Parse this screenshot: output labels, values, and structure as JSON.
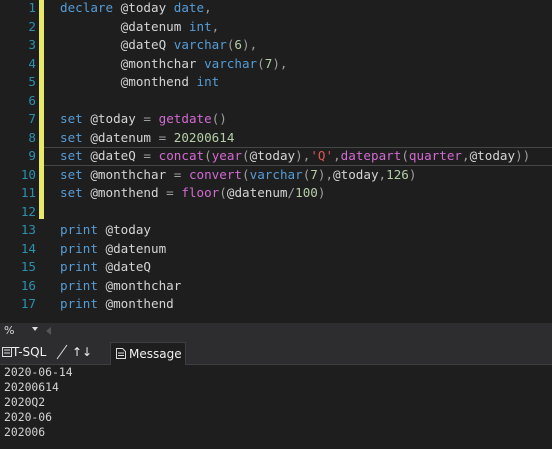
{
  "editor": {
    "lines": [
      {
        "n": "1",
        "tokens": [
          {
            "t": "declare",
            "c": "kw"
          },
          {
            "t": " @today ",
            "c": "var"
          },
          {
            "t": "date",
            "c": "kw"
          },
          {
            "t": ",",
            "c": "op"
          }
        ]
      },
      {
        "n": "2",
        "tokens": [
          {
            "t": "        @datenum ",
            "c": "var"
          },
          {
            "t": "int",
            "c": "kw"
          },
          {
            "t": ",",
            "c": "op"
          }
        ]
      },
      {
        "n": "3",
        "tokens": [
          {
            "t": "        @dateQ ",
            "c": "var"
          },
          {
            "t": "varchar",
            "c": "kw"
          },
          {
            "t": "(",
            "c": "op"
          },
          {
            "t": "6",
            "c": "num"
          },
          {
            "t": "),",
            "c": "op"
          }
        ]
      },
      {
        "n": "4",
        "tokens": [
          {
            "t": "        @monthchar ",
            "c": "var"
          },
          {
            "t": "varchar",
            "c": "kw"
          },
          {
            "t": "(",
            "c": "op"
          },
          {
            "t": "7",
            "c": "num"
          },
          {
            "t": "),",
            "c": "op"
          }
        ]
      },
      {
        "n": "5",
        "tokens": [
          {
            "t": "        @monthend ",
            "c": "var"
          },
          {
            "t": "int",
            "c": "kw"
          }
        ]
      },
      {
        "n": "6",
        "tokens": []
      },
      {
        "n": "7",
        "tokens": [
          {
            "t": "set",
            "c": "kw"
          },
          {
            "t": " @today ",
            "c": "var"
          },
          {
            "t": "=",
            "c": "op"
          },
          {
            "t": " ",
            "c": "var"
          },
          {
            "t": "getdate",
            "c": "fn"
          },
          {
            "t": "()",
            "c": "op"
          }
        ]
      },
      {
        "n": "8",
        "tokens": [
          {
            "t": "set",
            "c": "kw"
          },
          {
            "t": " @datenum ",
            "c": "var"
          },
          {
            "t": "=",
            "c": "op"
          },
          {
            "t": " ",
            "c": "var"
          },
          {
            "t": "20200614",
            "c": "num"
          }
        ]
      },
      {
        "n": "9",
        "tokens": [
          {
            "t": "set",
            "c": "kw"
          },
          {
            "t": " @dateQ ",
            "c": "var"
          },
          {
            "t": "=",
            "c": "op"
          },
          {
            "t": " ",
            "c": "var"
          },
          {
            "t": "concat",
            "c": "fn"
          },
          {
            "t": "(",
            "c": "op"
          },
          {
            "t": "year",
            "c": "fn"
          },
          {
            "t": "(",
            "c": "op"
          },
          {
            "t": "@today",
            "c": "var"
          },
          {
            "t": "),",
            "c": "op"
          },
          {
            "t": "'Q'",
            "c": "str"
          },
          {
            "t": ",",
            "c": "op"
          },
          {
            "t": "datepart",
            "c": "fn"
          },
          {
            "t": "(",
            "c": "op"
          },
          {
            "t": "quarter",
            "c": "fn"
          },
          {
            "t": ",",
            "c": "op"
          },
          {
            "t": "@today",
            "c": "var"
          },
          {
            "t": "))",
            "c": "op"
          }
        ]
      },
      {
        "n": "10",
        "tokens": [
          {
            "t": "set",
            "c": "kw"
          },
          {
            "t": " @monthchar ",
            "c": "var"
          },
          {
            "t": "=",
            "c": "op"
          },
          {
            "t": " ",
            "c": "var"
          },
          {
            "t": "convert",
            "c": "fn"
          },
          {
            "t": "(",
            "c": "op"
          },
          {
            "t": "varchar",
            "c": "kw"
          },
          {
            "t": "(",
            "c": "op"
          },
          {
            "t": "7",
            "c": "num"
          },
          {
            "t": "),",
            "c": "op"
          },
          {
            "t": "@today",
            "c": "var"
          },
          {
            "t": ",",
            "c": "op"
          },
          {
            "t": "126",
            "c": "num"
          },
          {
            "t": ")",
            "c": "op"
          }
        ]
      },
      {
        "n": "11",
        "tokens": [
          {
            "t": "set",
            "c": "kw"
          },
          {
            "t": " @monthend ",
            "c": "var"
          },
          {
            "t": "=",
            "c": "op"
          },
          {
            "t": " ",
            "c": "var"
          },
          {
            "t": "floor",
            "c": "fn"
          },
          {
            "t": "(",
            "c": "op"
          },
          {
            "t": "@datenum",
            "c": "var"
          },
          {
            "t": "/",
            "c": "op"
          },
          {
            "t": "100",
            "c": "num"
          },
          {
            "t": ")",
            "c": "op"
          }
        ]
      },
      {
        "n": "12",
        "tokens": []
      },
      {
        "n": "13",
        "tokens": [
          {
            "t": "print",
            "c": "kw"
          },
          {
            "t": " @today",
            "c": "var"
          }
        ]
      },
      {
        "n": "14",
        "tokens": [
          {
            "t": "print",
            "c": "kw"
          },
          {
            "t": " @datenum",
            "c": "var"
          }
        ]
      },
      {
        "n": "15",
        "tokens": [
          {
            "t": "print",
            "c": "kw"
          },
          {
            "t": " @dateQ",
            "c": "var"
          }
        ]
      },
      {
        "n": "16",
        "tokens": [
          {
            "t": "print",
            "c": "kw"
          },
          {
            "t": " @monthchar",
            "c": "var"
          }
        ]
      },
      {
        "n": "17",
        "tokens": [
          {
            "t": "print",
            "c": "kw"
          },
          {
            "t": " @monthend",
            "c": "var"
          }
        ]
      }
    ],
    "current_line": "9"
  },
  "statusbar": {
    "zoom": "%"
  },
  "tabs": {
    "tsql": "T-SQL",
    "sort_icon": "↑↓",
    "message": "Message"
  },
  "output": {
    "lines": [
      "2020-06-14",
      "20200614",
      "2020Q2",
      "2020-06",
      "202006"
    ]
  },
  "colors": {
    "keyword": "#569cd6",
    "function": "#d16ad1",
    "number": "#b5cea8",
    "string": "#e05555",
    "line_number": "#2b91af",
    "change_bar": "#e8e86a"
  }
}
